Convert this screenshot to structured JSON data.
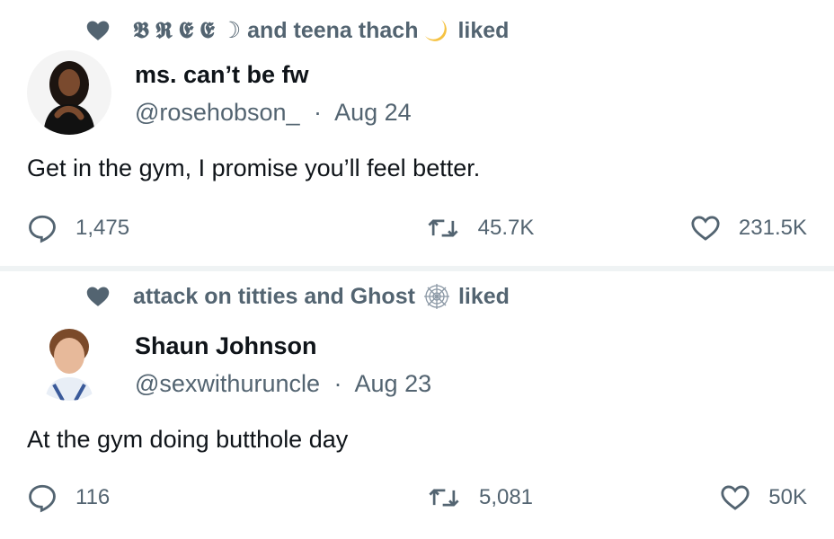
{
  "tweets": [
    {
      "social_context": {
        "liked_by_prefix": "𝕭 𝕽 𝕰 𝕰 ☽ and teena thach",
        "liked_suffix": "liked"
      },
      "author": {
        "name": "ms. can’t be fw",
        "handle": "@rosehobson_",
        "date": "Aug 24",
        "separator": "·"
      },
      "text": "Get in the gym, I promise you’ll feel better.",
      "stats": {
        "replies": "1,475",
        "retweets": "45.7K",
        "likes": "231.5K"
      }
    },
    {
      "social_context": {
        "liked_by_prefix": "attack on titties and Ghost",
        "liked_suffix": "liked"
      },
      "author": {
        "name": "Shaun Johnson",
        "handle": "@sexwithuruncle",
        "date": "Aug 23",
        "separator": "·"
      },
      "text": "At the gym doing butthole day",
      "stats": {
        "replies": "116",
        "retweets": "5,081",
        "likes": "50K"
      }
    }
  ],
  "colors": {
    "text": "#0f1419",
    "secondary": "#536471",
    "divider": "#eff3f4"
  },
  "icons": [
    "heart-icon",
    "moon-icon",
    "spiderweb-icon",
    "reply-icon",
    "retweet-icon",
    "like-icon"
  ]
}
